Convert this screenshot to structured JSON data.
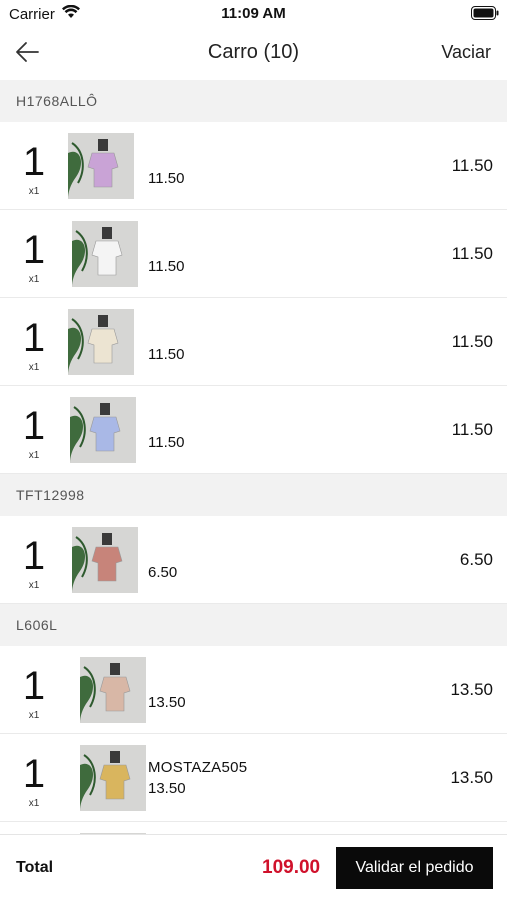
{
  "status_bar": {
    "carrier": "Carrier",
    "time": "11:09 AM"
  },
  "nav": {
    "back_icon": "arrow-left-icon",
    "title": "Carro (10)",
    "clear_label": "Vaciar"
  },
  "sections": [
    {
      "name": "H1768ALLÔ",
      "items": [
        {
          "qty": "1",
          "unit": "x1",
          "ref": "",
          "price": "11.50",
          "total": "11.50",
          "thumb_color": "#c9a3d6"
        },
        {
          "qty": "1",
          "unit": "x1",
          "ref": "",
          "price": "11.50",
          "total": "11.50",
          "thumb_color": "#f4f4f4"
        },
        {
          "qty": "1",
          "unit": "x1",
          "ref": "",
          "price": "11.50",
          "total": "11.50",
          "thumb_color": "#ece4d2"
        },
        {
          "qty": "1",
          "unit": "x1",
          "ref": "",
          "price": "11.50",
          "total": "11.50",
          "thumb_color": "#a9b8e6"
        }
      ]
    },
    {
      "name": "TFT12998",
      "items": [
        {
          "qty": "1",
          "unit": "x1",
          "ref": "",
          "price": "6.50",
          "total": "6.50",
          "thumb_color": "#c7847a"
        }
      ]
    },
    {
      "name": "L606L",
      "items": [
        {
          "qty": "1",
          "unit": "x1",
          "ref": "",
          "price": "13.50",
          "total": "13.50",
          "thumb_color": "#d8b7a6"
        },
        {
          "qty": "1",
          "unit": "x1",
          "ref": "MOSTAZA505",
          "price": "13.50",
          "total": "13.50",
          "thumb_color": "#d9b55e"
        },
        {
          "qty": "",
          "unit": "",
          "ref": "",
          "price": "",
          "total": "",
          "thumb_color": "#9fb3a0"
        }
      ]
    }
  ],
  "footer": {
    "total_label": "Total",
    "total_value": "109.00",
    "checkout_label": "Validar el pedido"
  },
  "colors": {
    "accent_price": "#d0112b",
    "button_bg": "#0a0a0a",
    "section_bg": "#f2f2f2"
  }
}
